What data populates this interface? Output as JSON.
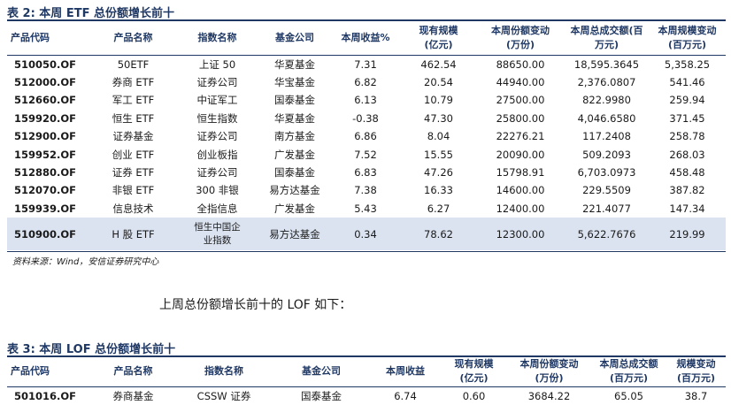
{
  "table2": {
    "caption": "表 2: 本周 ETF 总份额增长前十",
    "headers": [
      "产品代码",
      "产品名称",
      "指数名称",
      "基金公司",
      "本周收益%",
      "现有规模\n(亿元)",
      "本周份额变动\n(万份)",
      "本周总成交额(百\n万元)",
      "本周规模变动\n(百万元)"
    ],
    "rows": [
      [
        "510050.OF",
        "50ETF",
        "上证 50",
        "华夏基金",
        "7.31",
        "462.54",
        "88650.00",
        "18,595.3645",
        "5,358.25"
      ],
      [
        "512000.OF",
        "券商 ETF",
        "证券公司",
        "华宝基金",
        "6.82",
        "20.54",
        "44940.00",
        "2,376.0807",
        "541.46"
      ],
      [
        "512660.OF",
        "军工 ETF",
        "中证军工",
        "国泰基金",
        "6.13",
        "10.79",
        "27500.00",
        "822.9980",
        "259.94"
      ],
      [
        "159920.OF",
        "恒生 ETF",
        "恒生指数",
        "华夏基金",
        "-0.38",
        "47.30",
        "25800.00",
        "4,046.6580",
        "371.45"
      ],
      [
        "512900.OF",
        "证券基金",
        "证券公司",
        "南方基金",
        "6.86",
        "8.04",
        "22276.21",
        "117.2408",
        "258.78"
      ],
      [
        "159952.OF",
        "创业 ETF",
        "创业板指",
        "广发基金",
        "7.52",
        "15.55",
        "20090.00",
        "509.2093",
        "268.03"
      ],
      [
        "512880.OF",
        "证券 ETF",
        "证券公司",
        "国泰基金",
        "6.83",
        "47.26",
        "15798.91",
        "6,703.0973",
        "458.48"
      ],
      [
        "512070.OF",
        "非银 ETF",
        "300 非银",
        "易方达基金",
        "7.38",
        "16.33",
        "14600.00",
        "229.5509",
        "387.82"
      ],
      [
        "159939.OF",
        "信息技术",
        "全指信息",
        "广发基金",
        "5.43",
        "6.27",
        "12400.00",
        "221.4077",
        "147.34"
      ],
      [
        "510900.OF",
        "H 股 ETF",
        "恒生中国企\n业指数",
        "易方达基金",
        "0.34",
        "78.62",
        "12300.00",
        "5,622.7676",
        "219.99"
      ]
    ],
    "source": "资料来源：Wind，安信证券研究中心"
  },
  "paragraph": "上周总份额增长前十的 LOF 如下：",
  "table3": {
    "caption": "表 3: 本周 LOF 总份额增长前十",
    "headers": [
      "产品代码",
      "产品名称",
      "指数名称",
      "基金公司",
      "本周收益",
      "现有规模\n(亿元)",
      "本周份额变动\n(万份)",
      "本周总成交额\n(百万元)",
      "规模变动\n(百万元)"
    ],
    "rows": [
      [
        "501016.OF",
        "券商基金",
        "CSSW 证券",
        "国泰基金",
        "6.74",
        "0.60",
        "3684.22",
        "65.05",
        "38.7"
      ]
    ]
  },
  "colors": {
    "accent": "#1f3864",
    "highlight_row": "#dbe3f1"
  }
}
